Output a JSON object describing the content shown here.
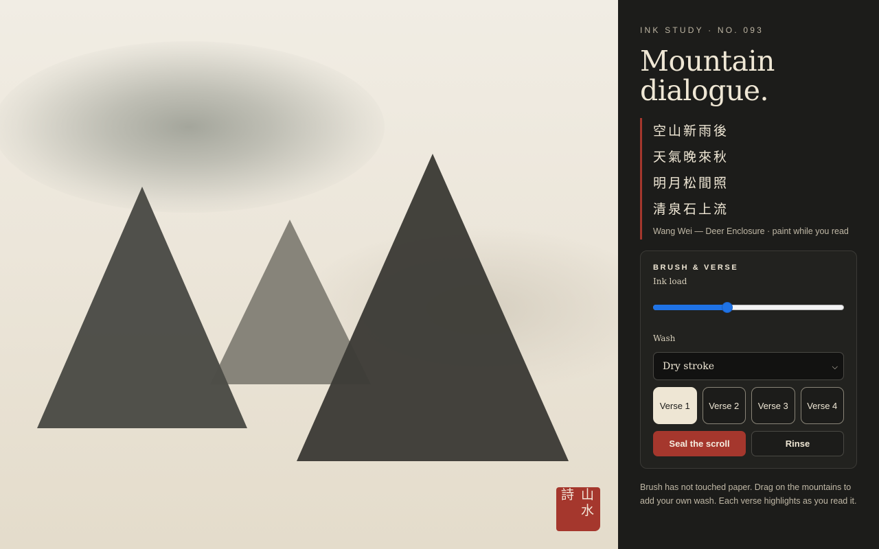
{
  "colors": {
    "paper": "#ece6da",
    "ink_dark": "#3d3c37",
    "ink_mid": "#4d4c47",
    "ink_light": "#817d74",
    "panel_bg": "#1c1c1a",
    "accent_red": "#a5372d",
    "slider_blue": "#1f73e6",
    "cream": "#eee6d4"
  },
  "seal": {
    "characters": [
      "詩",
      "山",
      "水"
    ]
  },
  "panel": {
    "eyebrow": "INK STUDY · NO. 093",
    "title_line1": "Mountain",
    "title_line2": "dialogue.",
    "poem": {
      "lines": [
        "空山新雨後",
        "天氣晚來秋",
        "明月松間照",
        "清泉石上流"
      ],
      "attribution": "Wang Wei — Deer Enclosure · paint while you read"
    },
    "controls": {
      "heading": "BRUSH & VERSE",
      "ink_load": {
        "label": "Ink load",
        "value_fraction": 0.39
      },
      "wash": {
        "label": "Wash",
        "selected": "Dry stroke"
      },
      "verses": [
        {
          "label": "Verse 1",
          "active": true
        },
        {
          "label": "Verse 2",
          "active": false
        },
        {
          "label": "Verse 3",
          "active": false
        },
        {
          "label": "Verse 4",
          "active": false
        }
      ],
      "seal_button": "Seal the scroll",
      "rinse_button": "Rinse"
    },
    "status": "Brush has not touched paper. Drag on the mountains to add your own wash. Each verse highlights as you read it."
  }
}
